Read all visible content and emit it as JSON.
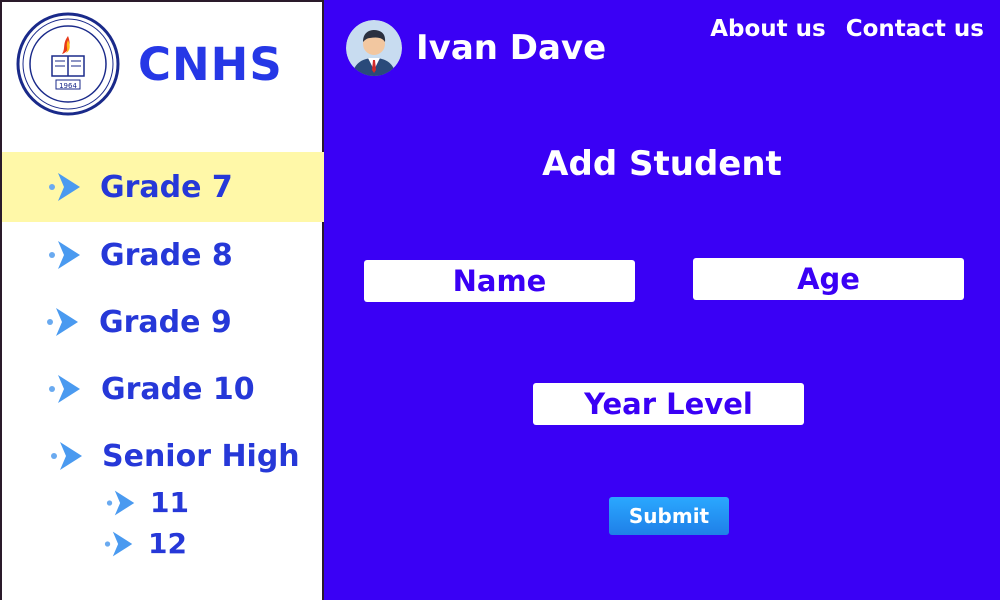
{
  "brand": {
    "name": "CNHS",
    "seal_text": "CANTAPOY NATIONAL HIGH SCHOOL",
    "seal_year": "1964"
  },
  "sidebar": {
    "items": [
      {
        "label": "Grade 7",
        "active": true,
        "icon": "chevron-arrow-icon"
      },
      {
        "label": "Grade 8",
        "active": false,
        "icon": "chevron-arrow-icon"
      },
      {
        "label": "Grade 9",
        "active": false,
        "icon": "chevron-arrow-icon"
      },
      {
        "label": "Grade 10",
        "active": false,
        "icon": "chevron-arrow-icon"
      },
      {
        "label": "Senior High",
        "active": false,
        "icon": "chevron-arrow-icon"
      }
    ],
    "sub_items": [
      {
        "label": "11"
      },
      {
        "label": "12"
      }
    ]
  },
  "header": {
    "user_name": "Ivan Dave",
    "links": [
      "About us",
      "Contact us"
    ]
  },
  "form": {
    "title": "Add Student",
    "name_placeholder": "Name",
    "age_placeholder": "Age",
    "year_level_placeholder": "Year Level",
    "submit_label": "Submit"
  },
  "colors": {
    "main_bg": "#3a00f5",
    "accent_blue": "#2638e6",
    "active_highlight": "#fff8a8",
    "arrow_blue": "#4a9af0"
  }
}
